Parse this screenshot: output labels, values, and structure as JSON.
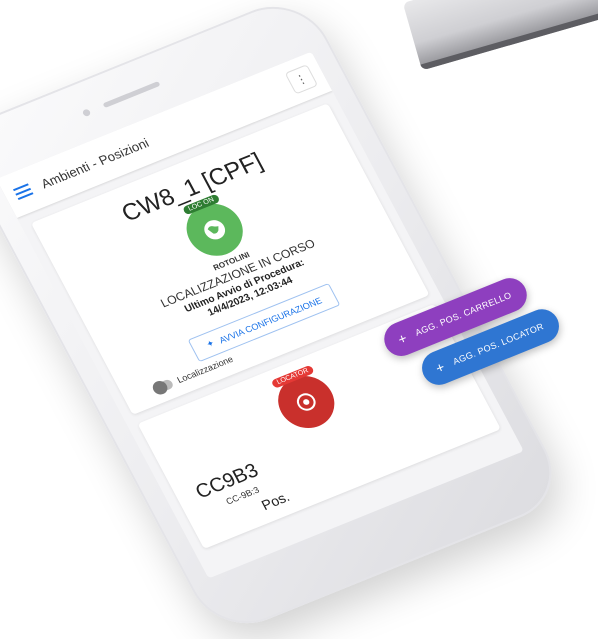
{
  "header": {
    "title": "Ambienti - Posizioni",
    "menu_glyph": "⋮"
  },
  "card1": {
    "title": "CW8_1 [CPF]",
    "badge": "LOC ON",
    "label": "ROTOLINI",
    "status": "LOCALIZZAZIONE IN CORSO",
    "last_run_label": "Ultimo Avvio di Procedura:",
    "last_run_value": "14/4/2023, 12:03:44",
    "config_button": "AVVIA CONFIGURAZIONE",
    "toggle_label": "Localizzazione"
  },
  "card2": {
    "badge": "LOCATOR",
    "title": "CC9B3",
    "subtitle": "CC-9B:3",
    "pos_label": "Pos."
  },
  "fabs": {
    "cart": "AGG. POS. CARRELLO",
    "locator": "AGG. POS. LOCATOR",
    "plus": "+"
  },
  "colors": {
    "accent_blue": "#1a73e8",
    "status_green": "#5cb85c",
    "locator_red": "#c9302c",
    "fab_purple": "#8e3fbf",
    "fab_blue": "#2f76d2"
  }
}
